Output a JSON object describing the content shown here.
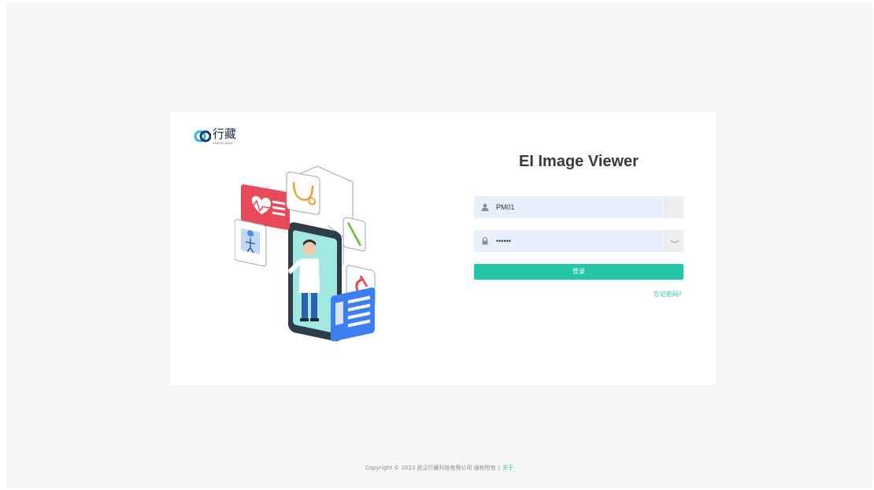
{
  "brand": {
    "logo_cn": "行藏",
    "logo_en": "XINGCANG",
    "accent": "#21c7a6"
  },
  "login": {
    "title": "EI Image Viewer",
    "username_value": "PM01",
    "password_value": "••••••",
    "login_button": "登录",
    "forgot_link": "忘记密码?"
  },
  "footer": {
    "copyright": "Copyright © 2023 武汉行藏科技有限公司 版权所有",
    "separator": "|",
    "about_link": "关于"
  },
  "icons": {
    "user": "user-icon",
    "lock": "lock-icon",
    "eye": "eye-closed-icon"
  }
}
